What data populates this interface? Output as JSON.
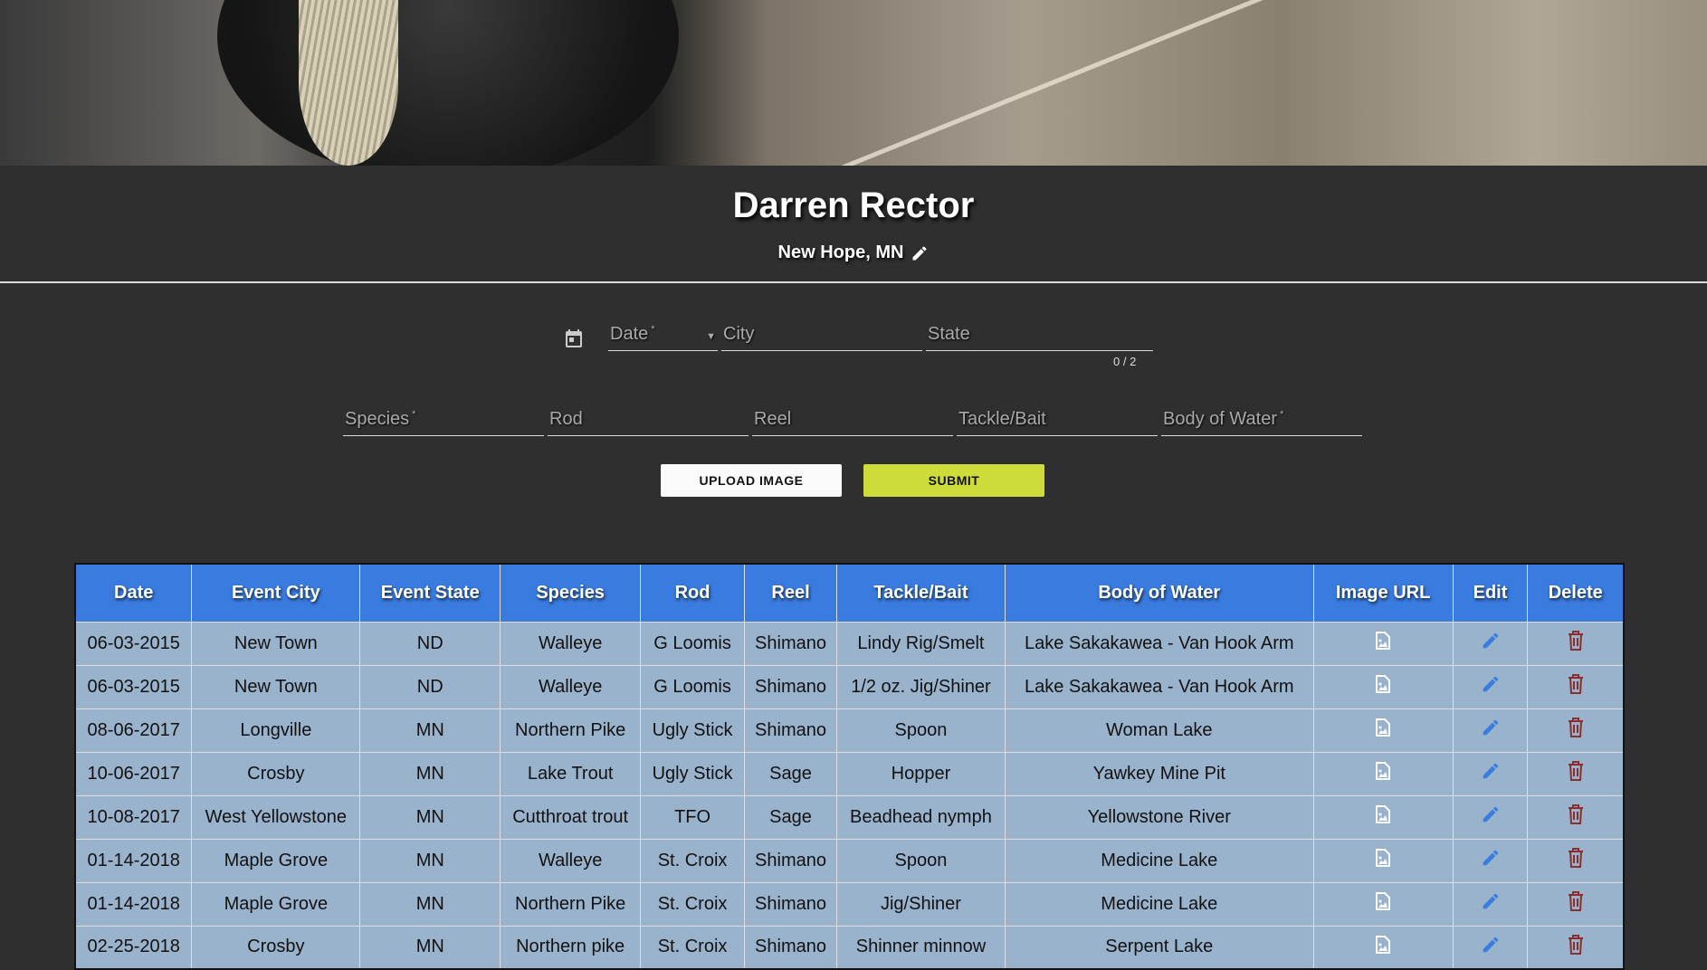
{
  "profile": {
    "name": "Darren Rector",
    "location": "New Hope, MN"
  },
  "form": {
    "date_label": "Date",
    "city_label": "City",
    "state_label": "State",
    "state_counter": "0 / 2",
    "species_label": "Species",
    "rod_label": "Rod",
    "reel_label": "Reel",
    "tackle_label": "Tackle/Bait",
    "water_label": "Body of Water",
    "required_mark": "*",
    "upload_label": "UPLOAD IMAGE",
    "submit_label": "SUBMIT"
  },
  "colors": {
    "header": "#3a7be0",
    "row": "#9ab3cc",
    "submit": "#cddc39",
    "edit": "#3a7be0",
    "delete": "#8b2d2d"
  },
  "table": {
    "headers": [
      "Date",
      "Event City",
      "Event State",
      "Species",
      "Rod",
      "Reel",
      "Tackle/Bait",
      "Body of Water",
      "Image URL",
      "Edit",
      "Delete"
    ],
    "rows": [
      [
        "06-03-2015",
        "New Town",
        "ND",
        "Walleye",
        "G Loomis",
        "Shimano",
        "Lindy Rig/Smelt",
        "Lake Sakakawea - Van Hook Arm"
      ],
      [
        "06-03-2015",
        "New Town",
        "ND",
        "Walleye",
        "G Loomis",
        "Shimano",
        "1/2 oz. Jig/Shiner",
        "Lake Sakakawea - Van Hook Arm"
      ],
      [
        "08-06-2017",
        "Longville",
        "MN",
        "Northern Pike",
        "Ugly Stick",
        "Shimano",
        "Spoon",
        "Woman Lake"
      ],
      [
        "10-06-2017",
        "Crosby",
        "MN",
        "Lake Trout",
        "Ugly Stick",
        "Sage",
        "Hopper",
        "Yawkey Mine Pit"
      ],
      [
        "10-08-2017",
        "West Yellowstone",
        "MN",
        "Cutthroat trout",
        "TFO",
        "Sage",
        "Beadhead nymph",
        "Yellowstone River"
      ],
      [
        "01-14-2018",
        "Maple Grove",
        "MN",
        "Walleye",
        "St. Croix",
        "Shimano",
        "Spoon",
        "Medicine Lake"
      ],
      [
        "01-14-2018",
        "Maple Grove",
        "MN",
        "Northern Pike",
        "St. Croix",
        "Shimano",
        "Jig/Shiner",
        "Medicine Lake"
      ],
      [
        "02-25-2018",
        "Crosby",
        "MN",
        "Northern pike",
        "St. Croix",
        "Shimano",
        "Shinner minnow",
        "Serpent Lake"
      ]
    ]
  }
}
